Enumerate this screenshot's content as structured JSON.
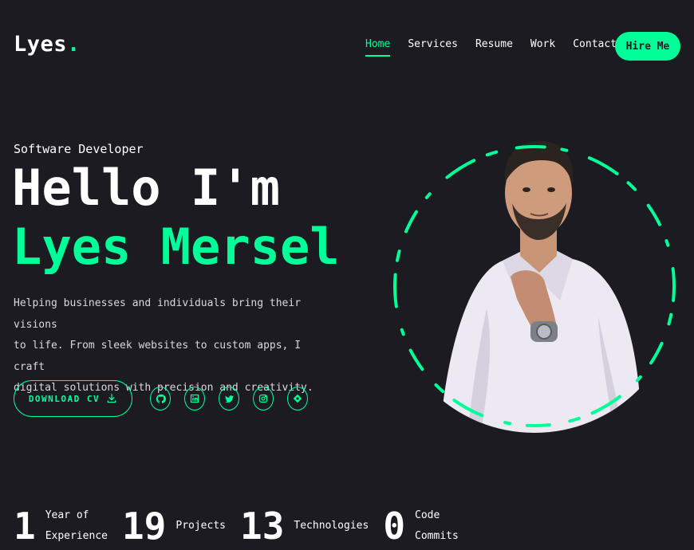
{
  "header": {
    "logo_text": "Lyes",
    "logo_dot": ".",
    "nav": [
      {
        "label": "Home",
        "active": true
      },
      {
        "label": "Services"
      },
      {
        "label": "Resume"
      },
      {
        "label": "Work"
      },
      {
        "label": "Contact"
      }
    ],
    "hire_label": "Hire Me"
  },
  "hero": {
    "subtitle": "Software Developer",
    "greeting": "Hello I'm",
    "name": "Lyes Mersel",
    "description_lines": [
      "Helping businesses and individuals bring their visions",
      "to life. From sleek websites to custom apps, I craft",
      "digital solutions with precision and creativity."
    ],
    "download_label": "DOWNLOAD CV",
    "socials": [
      "github-icon",
      "linkedin-icon",
      "twitter-icon",
      "instagram-icon",
      "hashnode-icon"
    ]
  },
  "stats": [
    {
      "number": "1",
      "label_lines": [
        "Year of",
        "Experience"
      ]
    },
    {
      "number": "19",
      "label_lines": [
        "Projects"
      ]
    },
    {
      "number": "13",
      "label_lines": [
        "Technologies"
      ]
    },
    {
      "number": "0",
      "label_lines": [
        "Code",
        "Commits"
      ]
    }
  ],
  "colors": {
    "background": "#1c1b22",
    "accent": "#00ff99",
    "text": "#ffffff"
  }
}
